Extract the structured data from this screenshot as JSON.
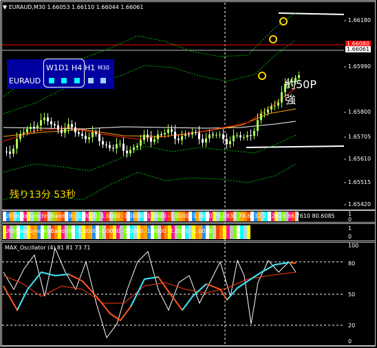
{
  "header": {
    "symbol": "EURAUD,M30",
    "ohlc": "1.66053 1.66110 1.66044 1.66061"
  },
  "price_scale": {
    "ticks": [
      "1.66180",
      "1.65990",
      "1.65800",
      "1.65705",
      "1.65610",
      "1.65515",
      "1.65420"
    ],
    "current_price": "1.66061",
    "red_level": "1.66080"
  },
  "timeframe_panel": {
    "symbol": "EURAUD",
    "labels": [
      "W1",
      "D1",
      "H4",
      "H1",
      "M30"
    ],
    "colors": {
      "panel": "#0000a0",
      "active": "#00ffff",
      "inactive": "#80c0ff"
    }
  },
  "annotation": {
    "line1": "約50P",
    "line2": "強"
  },
  "countdown": "残り13分 53秒",
  "usb1": {
    "title": "UltimateSynchroBand (9) -1.0000 -1.0000 -1.0000 -1.0000 -1.0000 -1.0000 75.0831 78.6232 73.2623 66.7610 80.6085",
    "scale_top": "1",
    "scale_bottom": "0"
  },
  "usb2": {
    "title": "UltimateSynchroBand (9) -1.0000 -1.0000 -1.0000 -1.0000 -1.0000 -1.0000",
    "scale_top": "1",
    "scale_bottom": "0"
  },
  "oscillator": {
    "title": "MAX_Oscillator (4) 81 81 73 71",
    "ticks": [
      "100",
      "80",
      "50",
      "20",
      "0"
    ]
  },
  "colors": {
    "bull": "#aaff55",
    "bear": "#ffffff",
    "ma_red": "#ff2000",
    "ma_white": "#ffffff",
    "ma_orange": "#ffa500",
    "band_green": "#00c000",
    "osc_cyan": "#33e6ff",
    "osc_orange": "#ff5a1e"
  }
}
